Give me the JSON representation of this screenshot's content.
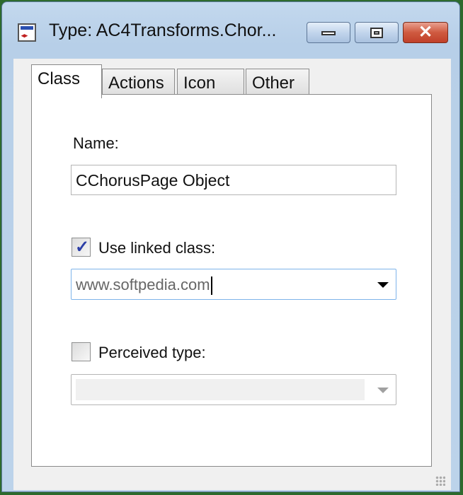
{
  "window": {
    "title": "Type: AC4Transforms.Chor...",
    "icon": "window-app-icon",
    "controls": {
      "minimize": "minimize-icon",
      "maximize": "maximize-icon",
      "close": "✕"
    }
  },
  "tabs": [
    {
      "label": "Class",
      "active": true
    },
    {
      "label": "Actions",
      "active": false
    },
    {
      "label": "Icon",
      "active": false
    },
    {
      "label": "Other",
      "active": false
    }
  ],
  "class_tab": {
    "name_label": "Name:",
    "name_value": "CChorusPage Object",
    "use_linked_label": "Use linked class:",
    "use_linked_checked": true,
    "linked_value": "www.softpedia.com",
    "perceived_label": "Perceived type:",
    "perceived_checked": false,
    "perceived_value": ""
  }
}
